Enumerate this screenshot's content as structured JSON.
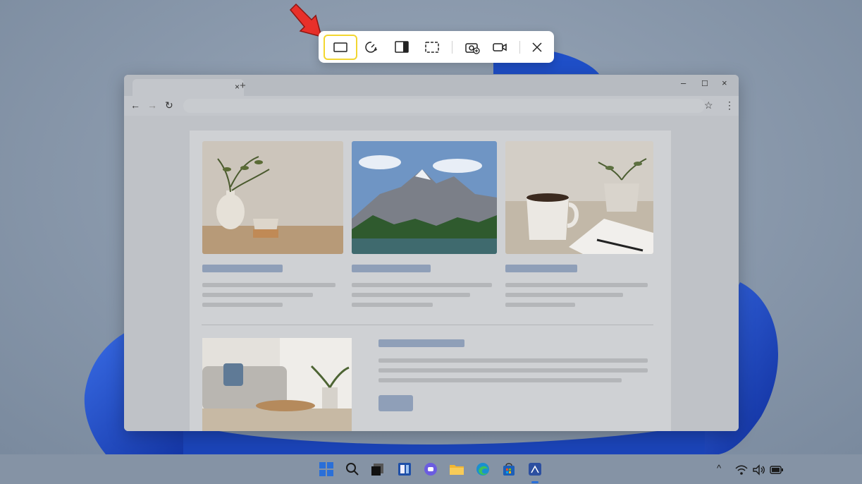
{
  "colors": {
    "accent_highlight": "#f2d630",
    "arrow": "#e8302a",
    "placeholder_blue": "#8f9fb8",
    "wallpaper_bloom": "#1f4fc8"
  },
  "snipping_toolbar": {
    "modes": [
      {
        "name": "rectangle-mode",
        "icon": "rectangle-icon",
        "selected": true
      },
      {
        "name": "freeform-mode",
        "icon": "freeform-icon",
        "selected": false
      },
      {
        "name": "window-mode",
        "icon": "window-mode-icon",
        "selected": false
      },
      {
        "name": "fullscreen-mode",
        "icon": "fullscreen-icon",
        "selected": false
      }
    ],
    "capture": [
      {
        "name": "screenshot-capture",
        "icon": "camera-icon"
      },
      {
        "name": "video-record",
        "icon": "video-icon"
      }
    ],
    "close_icon": "close-icon"
  },
  "browser": {
    "tab_close_glyph": "×",
    "new_tab_glyph": "+",
    "window_controls": {
      "minimize": "–",
      "maximize": "☐",
      "close": "×"
    },
    "nav": {
      "back": "←",
      "forward": "→",
      "reload": "↻",
      "star": "☆",
      "menu": "⋮"
    },
    "cards": [
      {
        "image": "vase-and-cup-photo"
      },
      {
        "image": "mountain-lake-photo"
      },
      {
        "image": "coffee-and-notebook-photo"
      }
    ],
    "feature": {
      "image": "living-room-photo"
    }
  },
  "taskbar": {
    "apps": [
      "start-icon",
      "search-icon",
      "task-view-icon",
      "widgets-icon",
      "chat-icon",
      "file-explorer-icon",
      "edge-icon",
      "store-icon",
      "snipping-tool-icon"
    ],
    "tray": {
      "chevron": "^",
      "wifi": "wifi-icon",
      "volume": "volume-icon",
      "battery": "battery-icon"
    }
  }
}
